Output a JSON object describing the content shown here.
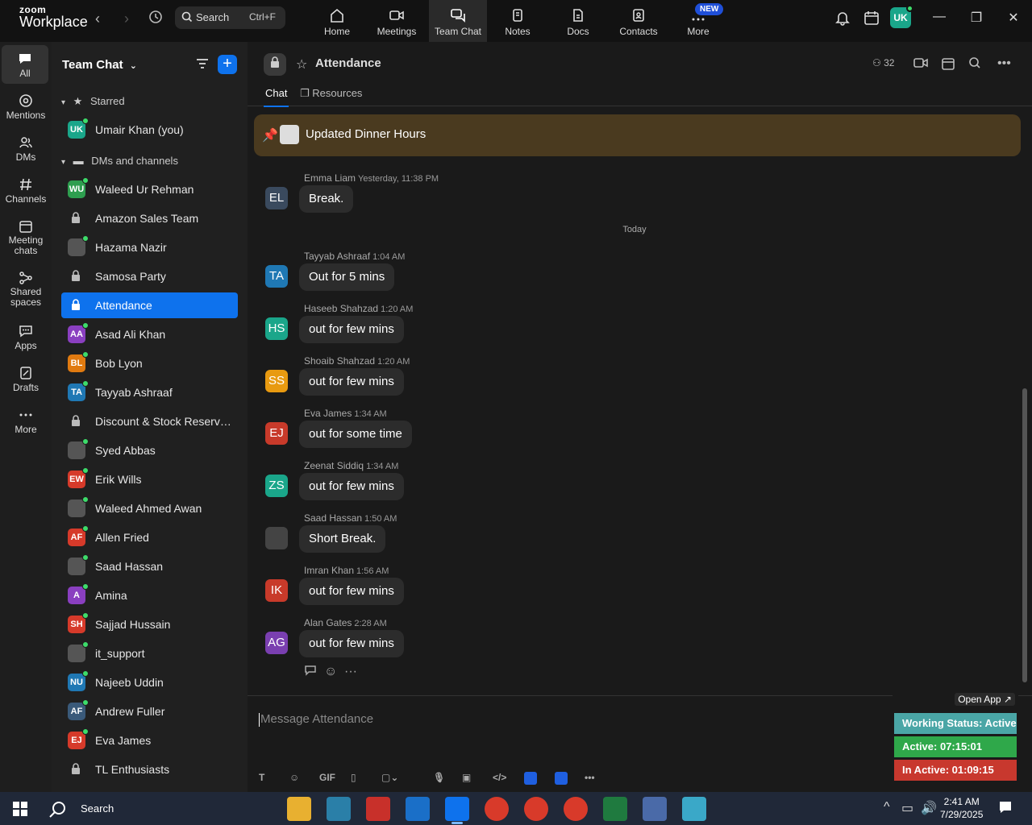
{
  "app": {
    "logo_line1": "zoom",
    "logo_line2": "Workplace"
  },
  "topbar": {
    "search_label": "Search",
    "search_shortcut": "Ctrl+F",
    "tabs": [
      {
        "label": "Home"
      },
      {
        "label": "Meetings"
      },
      {
        "label": "Team Chat"
      },
      {
        "label": "Notes"
      },
      {
        "label": "Docs"
      },
      {
        "label": "Contacts"
      },
      {
        "label": "More"
      }
    ],
    "new_badge": "NEW",
    "user_initials": "UK"
  },
  "rail": {
    "items": [
      {
        "label": "All"
      },
      {
        "label": "Mentions"
      },
      {
        "label": "DMs"
      },
      {
        "label": "Channels"
      },
      {
        "label": "Meeting chats"
      },
      {
        "label": "Shared spaces"
      },
      {
        "label": "Apps"
      },
      {
        "label": "Drafts"
      },
      {
        "label": "More"
      }
    ]
  },
  "sidebar": {
    "title": "Team Chat",
    "sections": {
      "starred": "Starred",
      "dms": "DMs and channels"
    },
    "starred_items": [
      {
        "initials": "UK",
        "name": "Umair Khan (you)",
        "color": "#1aa68a"
      }
    ],
    "items": [
      {
        "initials": "WU",
        "name": "Waleed Ur Rehman",
        "color": "#2e9e4f",
        "type": "avatar"
      },
      {
        "initials": "",
        "name": "Amazon Sales Team",
        "type": "lock"
      },
      {
        "initials": "",
        "name": "Hazama Nazir",
        "type": "photo"
      },
      {
        "initials": "",
        "name": "Samosa Party",
        "type": "lock"
      },
      {
        "initials": "",
        "name": "Attendance",
        "type": "lock",
        "active": true
      },
      {
        "initials": "AA",
        "name": "Asad Ali Khan",
        "color": "#8a3fc0",
        "type": "avatar"
      },
      {
        "initials": "BL",
        "name": "Bob Lyon",
        "color": "#e07a10",
        "type": "avatar"
      },
      {
        "initials": "TA",
        "name": "Tayyab Ashraaf",
        "color": "#1f78b4",
        "type": "avatar"
      },
      {
        "initials": "",
        "name": "Discount & Stock Reservati...",
        "type": "lock"
      },
      {
        "initials": "",
        "name": "Syed Abbas",
        "type": "photo"
      },
      {
        "initials": "EW",
        "name": "Erik Wills",
        "color": "#d63a2a",
        "type": "avatar"
      },
      {
        "initials": "",
        "name": "Waleed Ahmed Awan",
        "type": "photo"
      },
      {
        "initials": "AF",
        "name": "Allen Fried",
        "color": "#d63a2a",
        "type": "avatar"
      },
      {
        "initials": "",
        "name": "Saad Hassan",
        "type": "photo"
      },
      {
        "initials": "A",
        "name": "Amina",
        "color": "#8a3fc0",
        "type": "avatar"
      },
      {
        "initials": "SH",
        "name": "Sajjad Hussain",
        "color": "#d63a2a",
        "type": "avatar"
      },
      {
        "initials": "",
        "name": "it_support",
        "type": "photo"
      },
      {
        "initials": "NU",
        "name": "Najeeb Uddin",
        "color": "#1f78b4",
        "type": "avatar"
      },
      {
        "initials": "AF",
        "name": "Andrew Fuller",
        "color": "#3a5a7a",
        "type": "avatar"
      },
      {
        "initials": "EJ",
        "name": "Eva James",
        "color": "#d63a2a",
        "type": "avatar"
      },
      {
        "initials": "",
        "name": "TL Enthusiasts",
        "type": "lock"
      }
    ]
  },
  "channel": {
    "name": "Attendance",
    "member_count": "32",
    "tabs": [
      {
        "label": "Chat"
      },
      {
        "label": "Resources"
      }
    ],
    "pinned": "Updated Dinner Hours",
    "day_separator": "Today",
    "messages": [
      {
        "initials": "EL",
        "sender": "Emma Liam",
        "time": "Yesterday, 11:38 PM",
        "text": "Break.",
        "color": "#3a4a5e"
      },
      {
        "initials": "TA",
        "sender": "Tayyab Ashraaf",
        "time": "1:04 AM",
        "text": "Out for 5 mins",
        "color": "#1f78b4"
      },
      {
        "initials": "HS",
        "sender": "Haseeb Shahzad",
        "time": "1:20 AM",
        "text": "out for few mins",
        "color": "#1aa68a"
      },
      {
        "initials": "SS",
        "sender": "Shoaib Shahzad",
        "time": "1:20 AM",
        "text": "out for few mins",
        "color": "#e89a10"
      },
      {
        "initials": "EJ",
        "sender": "Eva James",
        "time": "1:34 AM",
        "text": "out for some time",
        "color": "#c83a2a"
      },
      {
        "initials": "ZS",
        "sender": "Zeenat Siddiq",
        "time": "1:34 AM",
        "text": "out for few mins",
        "color": "#1aa68a"
      },
      {
        "initials": "",
        "sender": "Saad Hassan",
        "time": "1:50 AM",
        "text": "Short Break.",
        "color": "#444"
      },
      {
        "initials": "IK",
        "sender": "Imran Khan",
        "time": "1:56 AM",
        "text": "out for few mins",
        "color": "#c83a2a"
      },
      {
        "initials": "AG",
        "sender": "Alan Gates",
        "time": "2:28 AM",
        "text": "out for few mins",
        "color": "#7a3fb0"
      }
    ],
    "composer_placeholder": "Message Attendance",
    "gif_label": "GIF"
  },
  "widget": {
    "open_app": "Open App ↗",
    "working_status": "Working Status: Active",
    "active": "Active: 07:15:01",
    "inactive": "In Active: 01:09:15",
    "colors": {
      "status": "#4aa6a6",
      "active": "#2fa84a",
      "inactive": "#c8382e"
    }
  },
  "taskbar": {
    "search_label": "Search",
    "time": "2:41 AM",
    "date": "7/29/2025"
  }
}
